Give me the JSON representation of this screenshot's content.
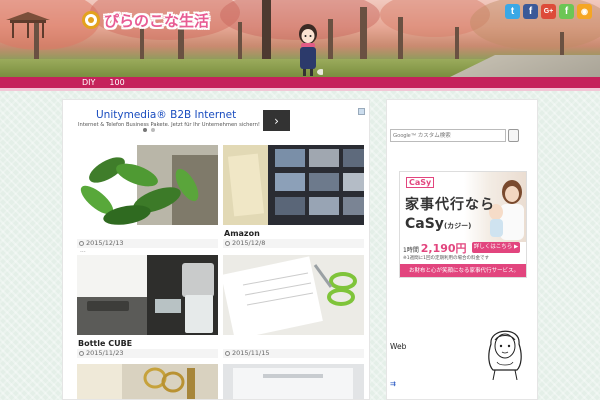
{
  "header": {
    "site_title": "ぴらのこな生活",
    "social": [
      {
        "name": "twitter",
        "glyph": "t",
        "color": "#3aa8e6"
      },
      {
        "name": "facebook",
        "glyph": "f",
        "color": "#3b5998"
      },
      {
        "name": "google-plus",
        "glyph": "G+",
        "color": "#dd4b39"
      },
      {
        "name": "feedly",
        "glyph": "f",
        "color": "#6cc655"
      },
      {
        "name": "rss",
        "glyph": "◉",
        "color": "#f5a623"
      }
    ]
  },
  "nav": {
    "items": [
      "DIY",
      "100"
    ]
  },
  "ad": {
    "title": "Unitymedia® B2B Internet",
    "description": "Internet & Telefon Business Pakete. Jetzt für Ihr Unternehmen sichern!",
    "next_glyph": "›"
  },
  "posts": [
    {
      "title": "",
      "date": "2015/12/13",
      "more": "..."
    },
    {
      "title": "Amazon",
      "date": "2015/12/8"
    },
    {
      "title": "Bottle CUBE",
      "date": "2015/11/23"
    },
    {
      "title": "",
      "date": "2015/11/15"
    }
  ],
  "sidebar": {
    "search_placeholder": "Google™ カスタム検索",
    "casy": {
      "logo": "CaSy",
      "headline1": "家事代行なら",
      "headline2": "CaSy",
      "headline2_suffix": "(カジー)",
      "price_prefix": "1時間",
      "price": "2,190円",
      "button": "詳しくはこちら ▶",
      "note": "※1週間に1回の定期利用の場合の料金です",
      "tagline": "お財布と心が笑顔になる家事代行サービス。"
    },
    "web_label": "Web",
    "arrow_link": "⇉"
  },
  "colors": {
    "nav_bg": "#c5225b",
    "logo_pink": "#e85d94",
    "ad_blue": "#1a4dbf"
  }
}
